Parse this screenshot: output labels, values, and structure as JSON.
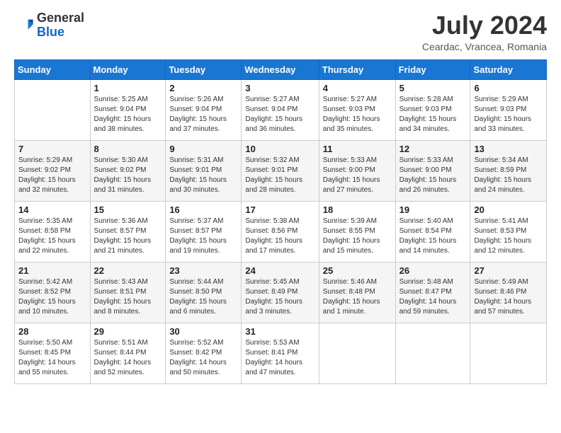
{
  "logo": {
    "general": "General",
    "blue": "Blue"
  },
  "title": "July 2024",
  "subtitle": "Ceardac, Vrancea, Romania",
  "weekdays": [
    "Sunday",
    "Monday",
    "Tuesday",
    "Wednesday",
    "Thursday",
    "Friday",
    "Saturday"
  ],
  "weeks": [
    [
      {
        "day": null,
        "info": null
      },
      {
        "day": "1",
        "info": "Sunrise: 5:25 AM\nSunset: 9:04 PM\nDaylight: 15 hours\nand 38 minutes."
      },
      {
        "day": "2",
        "info": "Sunrise: 5:26 AM\nSunset: 9:04 PM\nDaylight: 15 hours\nand 37 minutes."
      },
      {
        "day": "3",
        "info": "Sunrise: 5:27 AM\nSunset: 9:04 PM\nDaylight: 15 hours\nand 36 minutes."
      },
      {
        "day": "4",
        "info": "Sunrise: 5:27 AM\nSunset: 9:03 PM\nDaylight: 15 hours\nand 35 minutes."
      },
      {
        "day": "5",
        "info": "Sunrise: 5:28 AM\nSunset: 9:03 PM\nDaylight: 15 hours\nand 34 minutes."
      },
      {
        "day": "6",
        "info": "Sunrise: 5:29 AM\nSunset: 9:03 PM\nDaylight: 15 hours\nand 33 minutes."
      }
    ],
    [
      {
        "day": "7",
        "info": "Sunrise: 5:29 AM\nSunset: 9:02 PM\nDaylight: 15 hours\nand 32 minutes."
      },
      {
        "day": "8",
        "info": "Sunrise: 5:30 AM\nSunset: 9:02 PM\nDaylight: 15 hours\nand 31 minutes."
      },
      {
        "day": "9",
        "info": "Sunrise: 5:31 AM\nSunset: 9:01 PM\nDaylight: 15 hours\nand 30 minutes."
      },
      {
        "day": "10",
        "info": "Sunrise: 5:32 AM\nSunset: 9:01 PM\nDaylight: 15 hours\nand 28 minutes."
      },
      {
        "day": "11",
        "info": "Sunrise: 5:33 AM\nSunset: 9:00 PM\nDaylight: 15 hours\nand 27 minutes."
      },
      {
        "day": "12",
        "info": "Sunrise: 5:33 AM\nSunset: 9:00 PM\nDaylight: 15 hours\nand 26 minutes."
      },
      {
        "day": "13",
        "info": "Sunrise: 5:34 AM\nSunset: 8:59 PM\nDaylight: 15 hours\nand 24 minutes."
      }
    ],
    [
      {
        "day": "14",
        "info": "Sunrise: 5:35 AM\nSunset: 8:58 PM\nDaylight: 15 hours\nand 22 minutes."
      },
      {
        "day": "15",
        "info": "Sunrise: 5:36 AM\nSunset: 8:57 PM\nDaylight: 15 hours\nand 21 minutes."
      },
      {
        "day": "16",
        "info": "Sunrise: 5:37 AM\nSunset: 8:57 PM\nDaylight: 15 hours\nand 19 minutes."
      },
      {
        "day": "17",
        "info": "Sunrise: 5:38 AM\nSunset: 8:56 PM\nDaylight: 15 hours\nand 17 minutes."
      },
      {
        "day": "18",
        "info": "Sunrise: 5:39 AM\nSunset: 8:55 PM\nDaylight: 15 hours\nand 15 minutes."
      },
      {
        "day": "19",
        "info": "Sunrise: 5:40 AM\nSunset: 8:54 PM\nDaylight: 15 hours\nand 14 minutes."
      },
      {
        "day": "20",
        "info": "Sunrise: 5:41 AM\nSunset: 8:53 PM\nDaylight: 15 hours\nand 12 minutes."
      }
    ],
    [
      {
        "day": "21",
        "info": "Sunrise: 5:42 AM\nSunset: 8:52 PM\nDaylight: 15 hours\nand 10 minutes."
      },
      {
        "day": "22",
        "info": "Sunrise: 5:43 AM\nSunset: 8:51 PM\nDaylight: 15 hours\nand 8 minutes."
      },
      {
        "day": "23",
        "info": "Sunrise: 5:44 AM\nSunset: 8:50 PM\nDaylight: 15 hours\nand 6 minutes."
      },
      {
        "day": "24",
        "info": "Sunrise: 5:45 AM\nSunset: 8:49 PM\nDaylight: 15 hours\nand 3 minutes."
      },
      {
        "day": "25",
        "info": "Sunrise: 5:46 AM\nSunset: 8:48 PM\nDaylight: 15 hours\nand 1 minute."
      },
      {
        "day": "26",
        "info": "Sunrise: 5:48 AM\nSunset: 8:47 PM\nDaylight: 14 hours\nand 59 minutes."
      },
      {
        "day": "27",
        "info": "Sunrise: 5:49 AM\nSunset: 8:46 PM\nDaylight: 14 hours\nand 57 minutes."
      }
    ],
    [
      {
        "day": "28",
        "info": "Sunrise: 5:50 AM\nSunset: 8:45 PM\nDaylight: 14 hours\nand 55 minutes."
      },
      {
        "day": "29",
        "info": "Sunrise: 5:51 AM\nSunset: 8:44 PM\nDaylight: 14 hours\nand 52 minutes."
      },
      {
        "day": "30",
        "info": "Sunrise: 5:52 AM\nSunset: 8:42 PM\nDaylight: 14 hours\nand 50 minutes."
      },
      {
        "day": "31",
        "info": "Sunrise: 5:53 AM\nSunset: 8:41 PM\nDaylight: 14 hours\nand 47 minutes."
      },
      {
        "day": null,
        "info": null
      },
      {
        "day": null,
        "info": null
      },
      {
        "day": null,
        "info": null
      }
    ]
  ]
}
